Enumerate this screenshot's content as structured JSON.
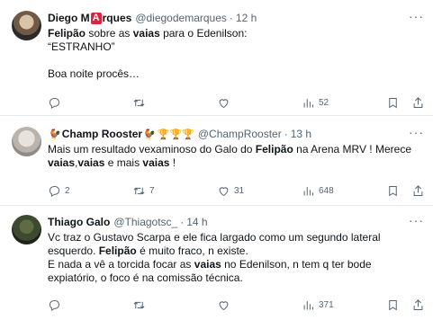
{
  "tweets": [
    {
      "name_pre": "Diego M",
      "name_logo": "A",
      "name_post": "rques",
      "handle": "@diegodemarques",
      "dot": "·",
      "time": "12 h",
      "body": [
        {
          "t": "Felipão",
          "b": true
        },
        {
          "t": " sobre as ",
          "b": false
        },
        {
          "t": "vaias",
          "b": true
        },
        {
          "t": " para o Edenilson:\n“ESTRANHO”\n\nBoa noite procês…",
          "b": false
        }
      ],
      "replies": "",
      "retweets": "",
      "likes": "",
      "views": "52"
    },
    {
      "name": "Champ Rooster",
      "handle": "@ChampRooster",
      "dot": "·",
      "time": "13 h",
      "body": [
        {
          "t": "Mais um resultado vexaminoso do Galo do ",
          "b": false
        },
        {
          "t": "Felipão",
          "b": true
        },
        {
          "t": " na Arena MRV ! Merece\n",
          "b": false
        },
        {
          "t": "vaias",
          "b": true
        },
        {
          "t": ",",
          "b": false
        },
        {
          "t": "vaias",
          "b": true
        },
        {
          "t": " e mais ",
          "b": false
        },
        {
          "t": "vaias",
          "b": true
        },
        {
          "t": " !",
          "b": false
        }
      ],
      "replies": "2",
      "retweets": "7",
      "likes": "31",
      "views": "648"
    },
    {
      "name": "Thiago Galo",
      "handle": "@Thiagotsc_",
      "dot": "·",
      "time": "14 h",
      "body": [
        {
          "t": "Vc traz o Gustavo Scarpa e ele fica largado como um segundo lateral\nesquerdo. ",
          "b": false
        },
        {
          "t": "Felipão",
          "b": true
        },
        {
          "t": " é muito fraco, n existe.\nE nada a vê a torcida focar as ",
          "b": false
        },
        {
          "t": "vaias",
          "b": true
        },
        {
          "t": " no Edenilson, n tem q ter bode\nexpiatório, o foco é na comissão técnica.",
          "b": false
        }
      ],
      "replies": "",
      "retweets": "",
      "likes": "",
      "views": "371"
    }
  ],
  "more_glyph": "···",
  "emoji_chicken": "🐓",
  "trophies": "🏆🏆🏆",
  "colors": {
    "text": "#0f1419",
    "muted": "#536471",
    "divider": "#e6ecf0",
    "logo_red": "#d7263d"
  },
  "icons": [
    "reply-icon",
    "retweet-icon",
    "like-icon",
    "views-icon",
    "bookmark-icon",
    "share-icon",
    "more-icon",
    "avatar"
  ]
}
